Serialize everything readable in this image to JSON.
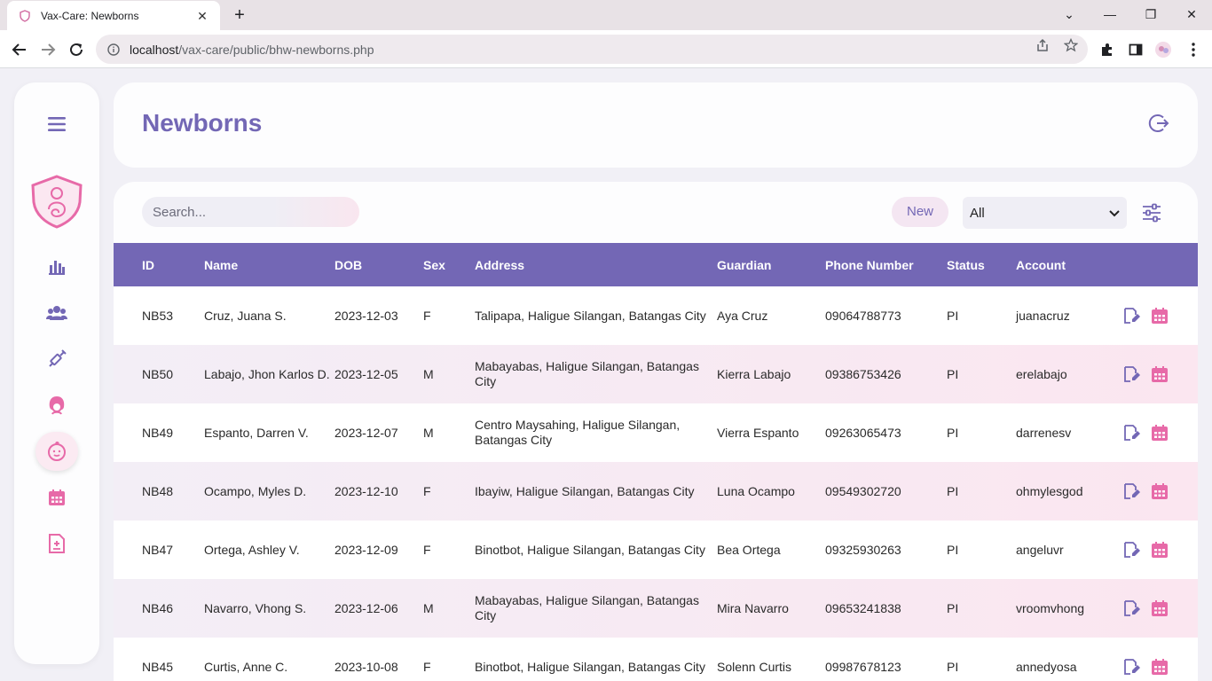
{
  "browser": {
    "tab_title": "Vax-Care: Newborns",
    "url_host": "localhost",
    "url_path": "/vax-care/public/bhw-newborns.php"
  },
  "header": {
    "title": "Newborns"
  },
  "controls": {
    "search_placeholder": "Search...",
    "new_label": "New",
    "filter_selected": "All"
  },
  "table": {
    "columns": [
      "ID",
      "Name",
      "DOB",
      "Sex",
      "Address",
      "Guardian",
      "Phone Number",
      "Status",
      "Account"
    ],
    "rows": [
      {
        "id": "NB53",
        "name": "Cruz, Juana S.",
        "dob": "2023-12-03",
        "sex": "F",
        "address": "Talipapa, Haligue Silangan, Batangas City",
        "guardian": "Aya Cruz",
        "phone": "09064788773",
        "status": "PI",
        "account": "juanacruz"
      },
      {
        "id": "NB50",
        "name": "Labajo, Jhon Karlos D.",
        "dob": "2023-12-05",
        "sex": "M",
        "address": "Mabayabas, Haligue Silangan, Batangas City",
        "guardian": "Kierra Labajo",
        "phone": "09386753426",
        "status": "PI",
        "account": "erelabajo"
      },
      {
        "id": "NB49",
        "name": "Espanto, Darren V.",
        "dob": "2023-12-07",
        "sex": "M",
        "address": "Centro Maysahing, Haligue Silangan, Batangas City",
        "guardian": "Vierra Espanto",
        "phone": "09263065473",
        "status": "PI",
        "account": "darrenesv"
      },
      {
        "id": "NB48",
        "name": "Ocampo, Myles D.",
        "dob": "2023-12-10",
        "sex": "F",
        "address": "Ibayiw, Haligue Silangan, Batangas City",
        "guardian": "Luna Ocampo",
        "phone": "09549302720",
        "status": "PI",
        "account": "ohmylesgod"
      },
      {
        "id": "NB47",
        "name": "Ortega, Ashley V.",
        "dob": "2023-12-09",
        "sex": "F",
        "address": "Binotbot, Haligue Silangan, Batangas City",
        "guardian": "Bea Ortega",
        "phone": "09325930263",
        "status": "PI",
        "account": "angeluvr"
      },
      {
        "id": "NB46",
        "name": "Navarro, Vhong S.",
        "dob": "2023-12-06",
        "sex": "M",
        "address": "Mabayabas, Haligue Silangan, Batangas City",
        "guardian": "Mira Navarro",
        "phone": "09653241838",
        "status": "PI",
        "account": "vroomvhong"
      },
      {
        "id": "NB45",
        "name": "Curtis, Anne C.",
        "dob": "2023-10-08",
        "sex": "F",
        "address": "Binotbot, Haligue Silangan, Batangas City",
        "guardian": "Solenn Curtis",
        "phone": "09987678123",
        "status": "PI",
        "account": "annedyosa"
      }
    ]
  },
  "sidebar": {
    "items": [
      "menu-icon",
      "chart-icon",
      "users-icon",
      "syringe-icon",
      "mother-icon",
      "baby-icon",
      "calendar-icon",
      "report-icon"
    ],
    "active": "baby-icon"
  },
  "colors": {
    "accent": "#7367b5",
    "pink": "#e76aa8",
    "row_alt": "#fbe6f0"
  }
}
